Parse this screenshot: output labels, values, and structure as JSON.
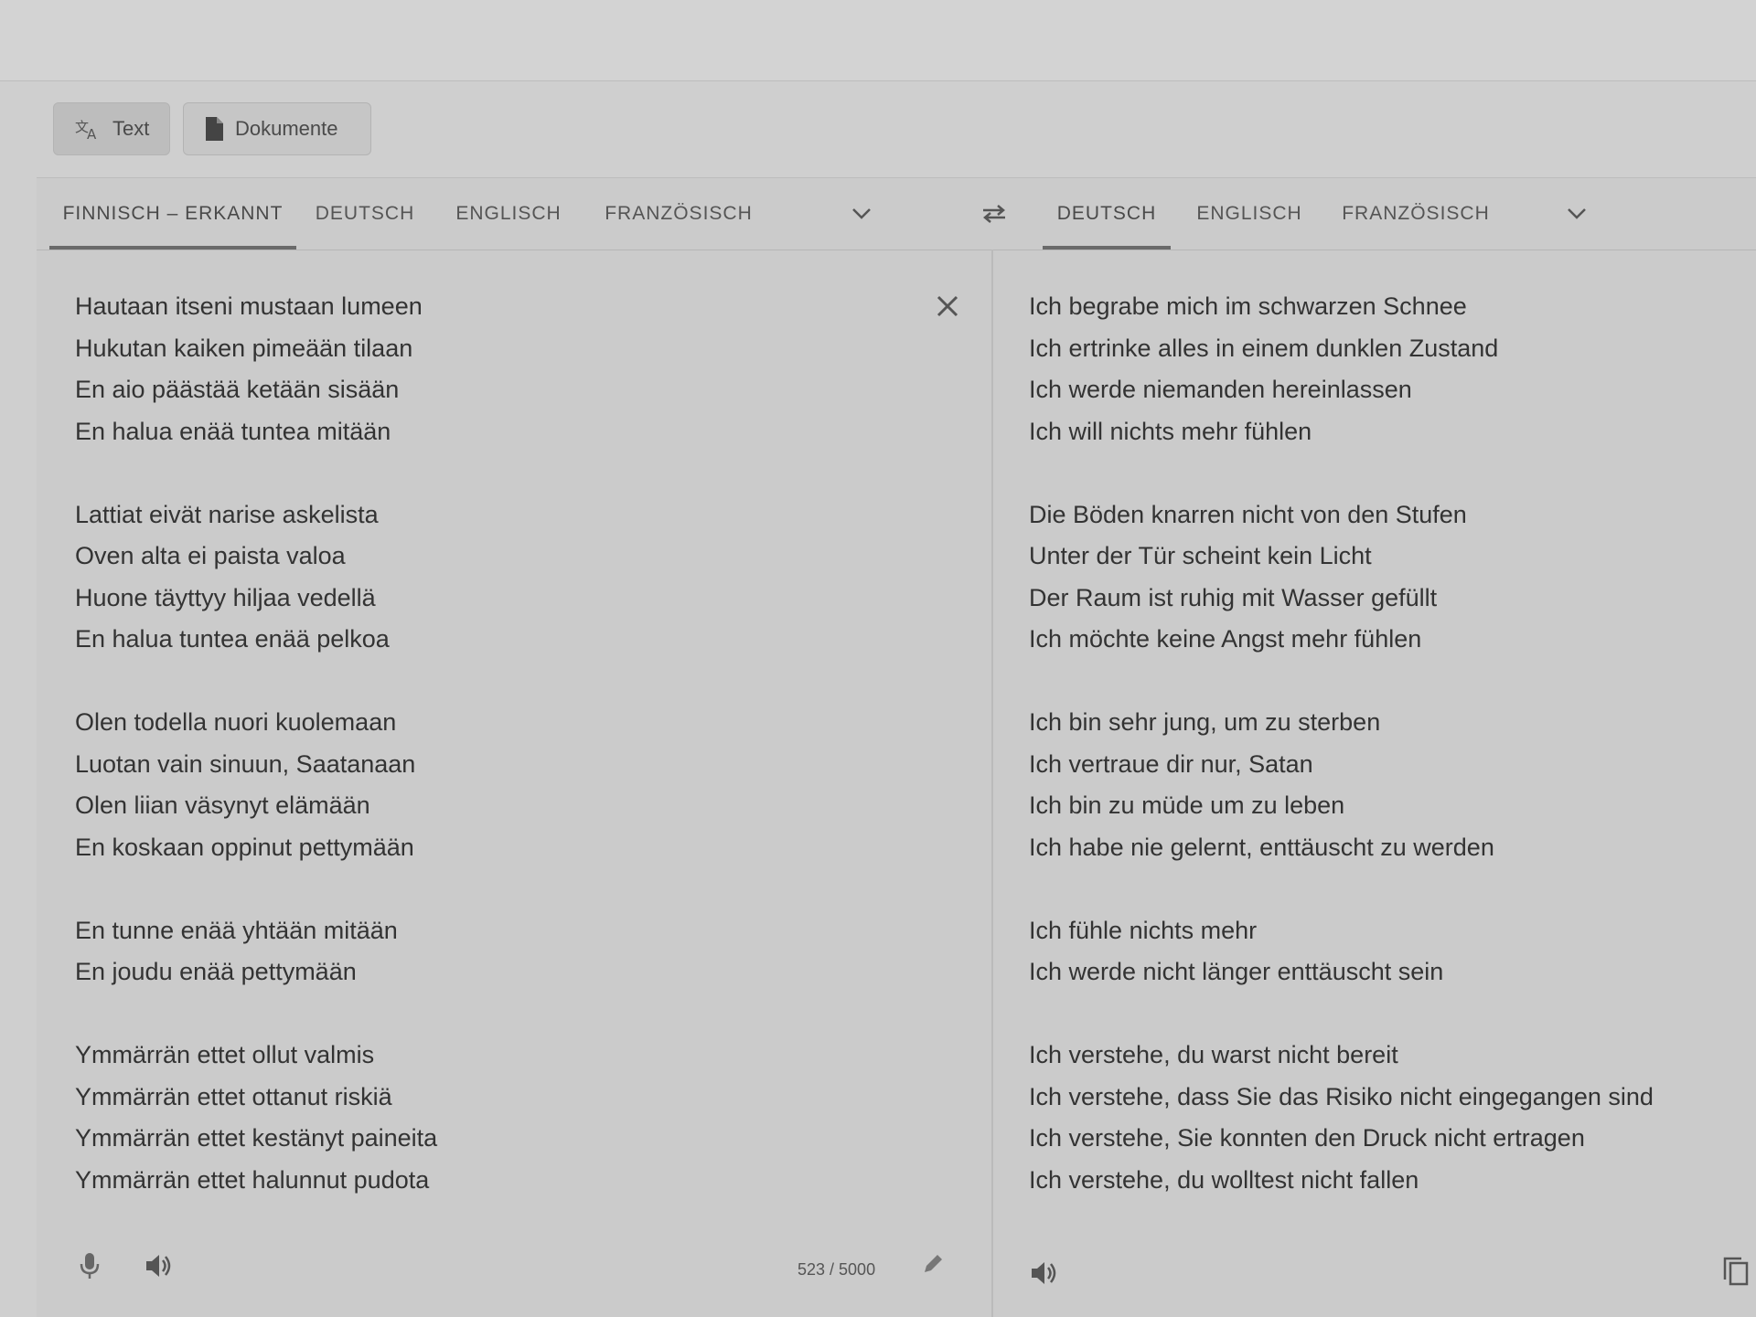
{
  "modes": {
    "text_label": "Text",
    "documents_label": "Dokumente"
  },
  "source_tabs": [
    {
      "label": "FINNISCH – ERKANNT",
      "active": true
    },
    {
      "label": "DEUTSCH",
      "active": false
    },
    {
      "label": "ENGLISCH",
      "active": false
    },
    {
      "label": "FRANZÖSISCH",
      "active": false
    }
  ],
  "target_tabs": [
    {
      "label": "DEUTSCH",
      "active": true
    },
    {
      "label": "ENGLISCH",
      "active": false
    },
    {
      "label": "FRANZÖSISCH",
      "active": false
    }
  ],
  "source_text": [
    [
      "Hautaan itseni mustaan lumeen",
      "Hukutan kaiken pimeään tilaan",
      "En aio päästää ketään sisään",
      "En halua enää tuntea mitään"
    ],
    [
      "Lattiat eivät narise askelista",
      "Oven alta ei paista valoa",
      "Huone täyttyy hiljaa vedellä",
      "En halua tuntea enää pelkoa"
    ],
    [
      "Olen todella nuori kuolemaan",
      "Luotan vain sinuun, Saatanaan",
      "Olen liian väsynyt elämään",
      "En koskaan oppinut pettymään"
    ],
    [
      "En tunne enää yhtään mitään",
      "En joudu enää pettymään"
    ],
    [
      "Ymmärrän ettet ollut valmis",
      "Ymmärrän ettet ottanut riskiä",
      "Ymmärrän ettet kestänyt paineita",
      "Ymmärrän ettet halunnut pudota"
    ]
  ],
  "target_text": [
    [
      "Ich begrabe mich im schwarzen Schnee",
      "Ich ertrinke alles in einem dunklen Zustand",
      "Ich werde niemanden hereinlassen",
      "Ich will nichts mehr fühlen"
    ],
    [
      "Die Böden knarren nicht von den Stufen",
      "Unter der Tür scheint kein Licht",
      "Der Raum ist ruhig mit Wasser gefüllt",
      "Ich möchte keine Angst mehr fühlen"
    ],
    [
      "Ich bin sehr jung, um zu sterben",
      "Ich vertraue dir nur, Satan",
      "Ich bin zu müde um zu leben",
      "Ich habe nie gelernt, enttäuscht zu werden"
    ],
    [
      "Ich fühle nichts mehr",
      "Ich werde nicht länger enttäuscht sein"
    ],
    [
      "Ich verstehe, du warst nicht bereit",
      "Ich verstehe, dass Sie das Risiko nicht eingegangen sind",
      "Ich verstehe, Sie konnten den Druck nicht ertragen",
      "Ich verstehe, du wolltest nicht fallen"
    ]
  ],
  "char_count": "523 / 5000",
  "icons": {
    "text_mode": "translate-icon",
    "documents_mode": "document-icon",
    "expand": "chevron-down-icon",
    "swap": "swap-icon",
    "clear": "close-icon",
    "mic": "microphone-icon",
    "speaker": "speaker-icon",
    "edit": "pencil-icon",
    "copy": "copy-icon"
  }
}
